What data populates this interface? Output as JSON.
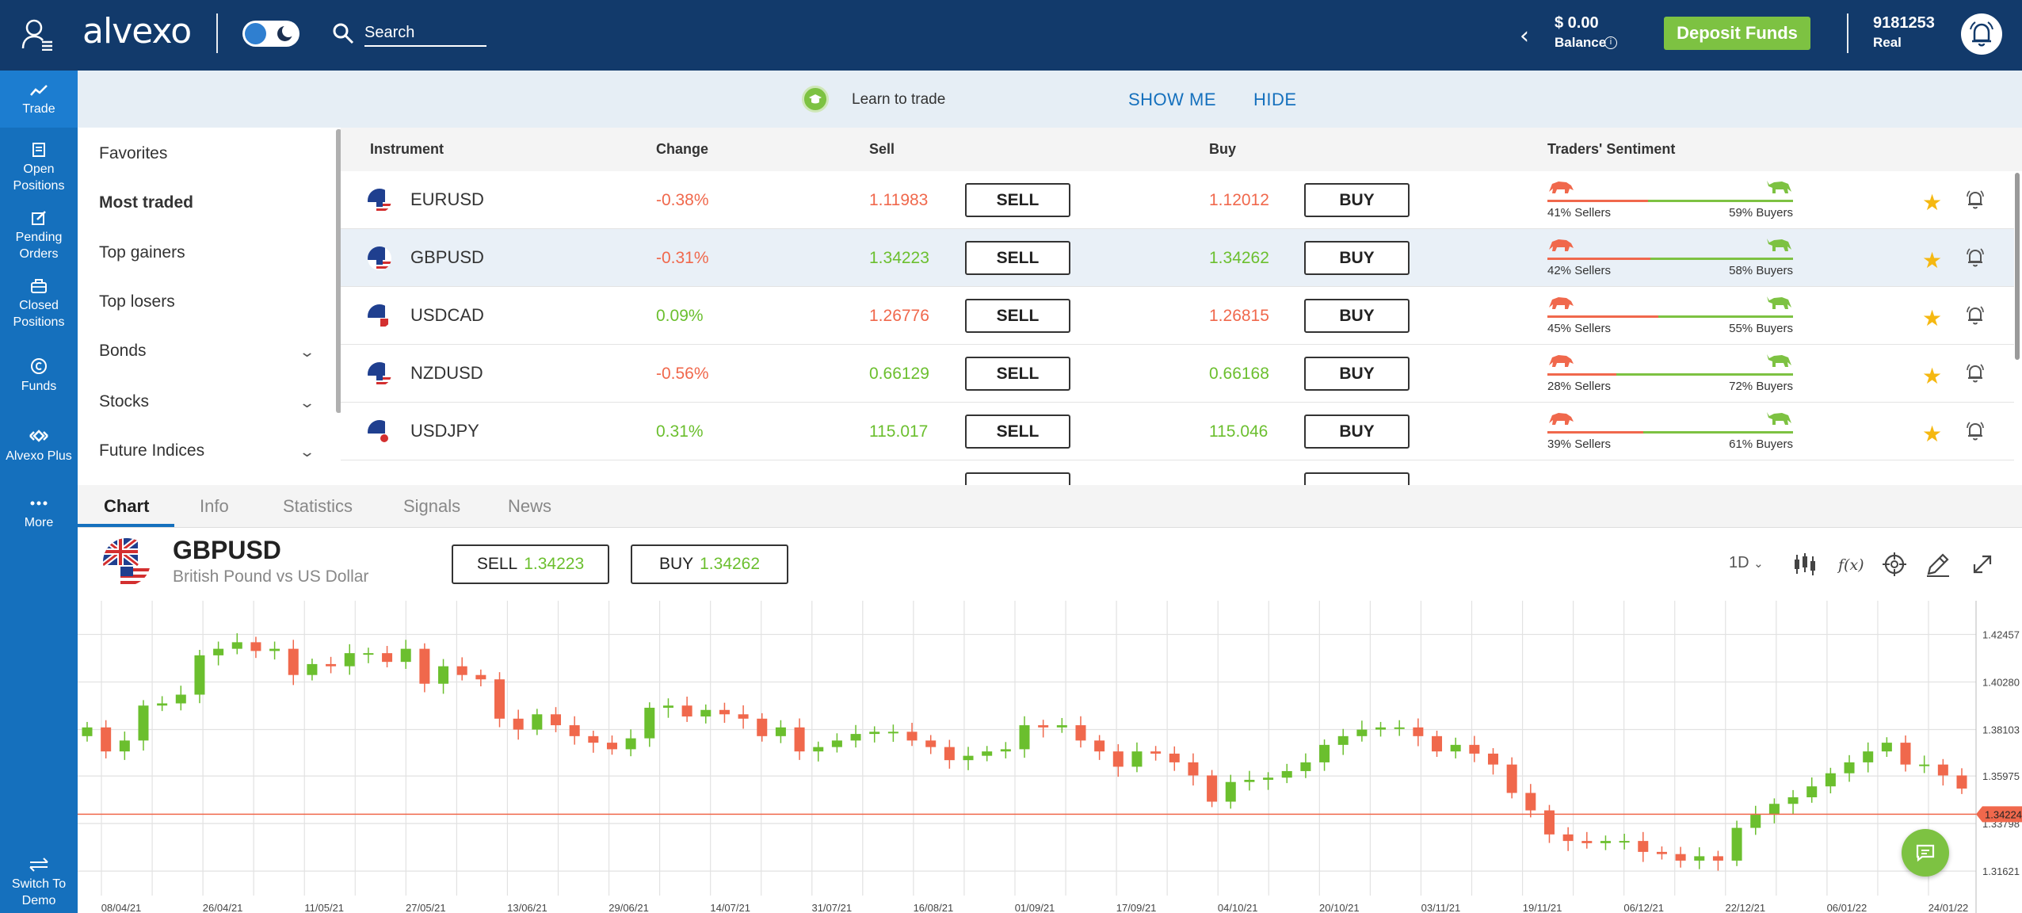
{
  "header": {
    "logo": "alvexo",
    "search_placeholder": "Search",
    "balance_amount": "$ 0.00",
    "balance_label": "Balance",
    "deposit_label": "Deposit Funds",
    "account_number": "9181253",
    "account_type": "Real"
  },
  "nav": {
    "items": [
      {
        "label": "Trade",
        "icon": "trade-chart-icon"
      },
      {
        "label": "Open Positions",
        "icon": "document-icon"
      },
      {
        "label": "Pending Orders",
        "icon": "edit-icon"
      },
      {
        "label": "Closed Positions",
        "icon": "briefcase-icon"
      },
      {
        "label": "Funds",
        "icon": "currency-icon"
      },
      {
        "label": "Alvexo Plus",
        "icon": "diamond-icon"
      },
      {
        "label": "More",
        "icon": "ellipsis-icon"
      }
    ],
    "switch_label": "Switch To Demo"
  },
  "learn_bar": {
    "text": "Learn to trade",
    "show_me": "SHOW ME",
    "hide": "HIDE"
  },
  "categories": [
    {
      "label": "Favorites",
      "bold": false,
      "expandable": false
    },
    {
      "label": "Most traded",
      "bold": true,
      "expandable": false
    },
    {
      "label": "Top gainers",
      "bold": false,
      "expandable": false
    },
    {
      "label": "Top losers",
      "bold": false,
      "expandable": false
    },
    {
      "label": "Bonds",
      "bold": false,
      "expandable": true
    },
    {
      "label": "Stocks",
      "bold": false,
      "expandable": true
    },
    {
      "label": "Future Indices",
      "bold": false,
      "expandable": true
    }
  ],
  "table": {
    "headers": {
      "instrument": "Instrument",
      "change": "Change",
      "sell": "Sell",
      "buy": "Buy",
      "sentiment": "Traders' Sentiment"
    },
    "sell_label": "SELL",
    "buy_label": "BUY",
    "rows": [
      {
        "symbol": "EURUSD",
        "change": "-0.38%",
        "sell": "1.11983",
        "buy": "1.12012",
        "price_dir": "down",
        "sellers_pct": 41,
        "sellers": "41% Sellers",
        "buyers": "59% Buyers",
        "selected": false
      },
      {
        "symbol": "GBPUSD",
        "change": "-0.31%",
        "sell": "1.34223",
        "buy": "1.34262",
        "price_dir": "up",
        "sellers_pct": 42,
        "sellers": "42% Sellers",
        "buyers": "58% Buyers",
        "selected": true
      },
      {
        "symbol": "USDCAD",
        "change": "0.09%",
        "sell": "1.26776",
        "buy": "1.26815",
        "price_dir": "down",
        "sellers_pct": 45,
        "sellers": "45% Sellers",
        "buyers": "55% Buyers",
        "selected": false
      },
      {
        "symbol": "NZDUSD",
        "change": "-0.56%",
        "sell": "0.66129",
        "buy": "0.66168",
        "price_dir": "up",
        "sellers_pct": 28,
        "sellers": "28% Sellers",
        "buyers": "72% Buyers",
        "selected": false
      },
      {
        "symbol": "USDJPY",
        "change": "0.31%",
        "sell": "115.017",
        "buy": "115.046",
        "price_dir": "up",
        "sellers_pct": 39,
        "sellers": "39% Sellers",
        "buyers": "61% Buyers",
        "selected": false
      }
    ]
  },
  "tabs": [
    "Chart",
    "Info",
    "Statistics",
    "Signals",
    "News"
  ],
  "chart_panel": {
    "symbol": "GBPUSD",
    "description": "British Pound vs US Dollar",
    "sell_label": "SELL",
    "sell_price": "1.34223",
    "buy_label": "BUY",
    "buy_price": "1.34262",
    "timeframe": "1D"
  },
  "colors": {
    "up": "#6bbf2e",
    "down": "#f0684c",
    "brand": "#1570bd",
    "header": "#123a6b",
    "deposit": "#7dc242"
  },
  "chart_data": {
    "type": "candlestick",
    "symbol": "GBPUSD",
    "timeframe": "1D",
    "y_ticks": [
      "1.42457",
      "1.40280",
      "1.38103",
      "1.35975",
      "1.33798",
      "1.31621"
    ],
    "ylim": [
      1.305,
      1.44
    ],
    "current_price": "1.34224",
    "current_value": 1.34224,
    "x_ticks": [
      "08/04/21",
      "26/04/21",
      "11/05/21",
      "27/05/21",
      "13/06/21",
      "29/06/21",
      "14/07/21",
      "31/07/21",
      "16/08/21",
      "01/09/21",
      "17/09/21",
      "04/10/21",
      "20/10/21",
      "03/11/21",
      "19/11/21",
      "06/12/21",
      "22/12/21",
      "06/01/22",
      "24/01/22"
    ],
    "closes": [
      1.382,
      1.371,
      1.376,
      1.392,
      1.393,
      1.397,
      1.415,
      1.418,
      1.421,
      1.417,
      1.418,
      1.406,
      1.411,
      1.41,
      1.416,
      1.416,
      1.412,
      1.418,
      1.402,
      1.41,
      1.406,
      1.404,
      1.386,
      1.381,
      1.388,
      1.383,
      1.378,
      1.375,
      1.372,
      1.377,
      1.391,
      1.392,
      1.387,
      1.39,
      1.388,
      1.386,
      1.378,
      1.382,
      1.371,
      1.373,
      1.376,
      1.379,
      1.38,
      1.38,
      1.376,
      1.373,
      1.367,
      1.369,
      1.371,
      1.372,
      1.383,
      1.382,
      1.383,
      1.376,
      1.371,
      1.364,
      1.371,
      1.37,
      1.366,
      1.36,
      1.348,
      1.357,
      1.358,
      1.359,
      1.362,
      1.366,
      1.374,
      1.378,
      1.381,
      1.382,
      1.382,
      1.378,
      1.371,
      1.374,
      1.37,
      1.365,
      1.352,
      1.344,
      1.333,
      1.33,
      1.329,
      1.33,
      1.33,
      1.325,
      1.324,
      1.321,
      1.323,
      1.321,
      1.336,
      1.342,
      1.347,
      1.35,
      1.355,
      1.361,
      1.366,
      1.371,
      1.375,
      1.365,
      1.365,
      1.36,
      1.354
    ]
  }
}
